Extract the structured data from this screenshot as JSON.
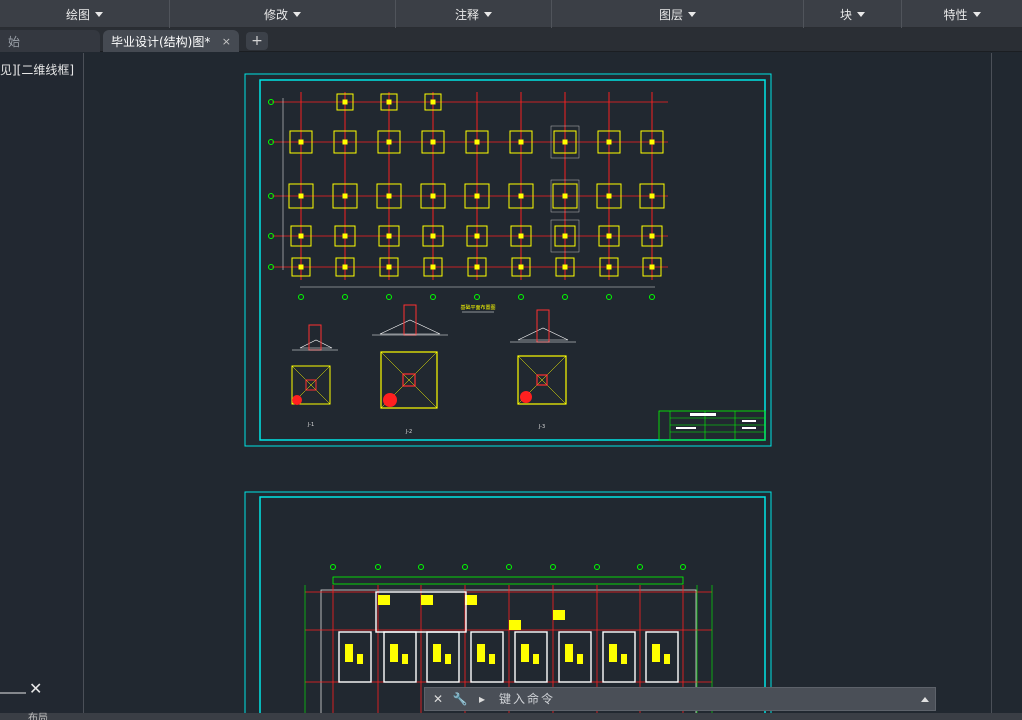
{
  "ribbon": {
    "groups": [
      {
        "label": "绘图"
      },
      {
        "label": "修改"
      },
      {
        "label": "注释"
      },
      {
        "label": "图层"
      },
      {
        "label": "块"
      },
      {
        "label": "特性"
      }
    ]
  },
  "tabs": {
    "start": "始",
    "active": "毕业设计(结构)图*",
    "close": "×",
    "add": "+"
  },
  "viewport": {
    "label": "见][二维线框]"
  },
  "drawing": {
    "sheet1_title": "基础平面布置图",
    "section_labels": [
      "J-1",
      "J-2",
      "J-3"
    ]
  },
  "command": {
    "placeholder": "键入命令"
  },
  "statusbar": {
    "layout": "布局"
  },
  "colors": {
    "background": "#212830",
    "grid": "#ff2020",
    "footing": "#ffff00",
    "border": "#00ffff",
    "axis": "#00ff00"
  }
}
